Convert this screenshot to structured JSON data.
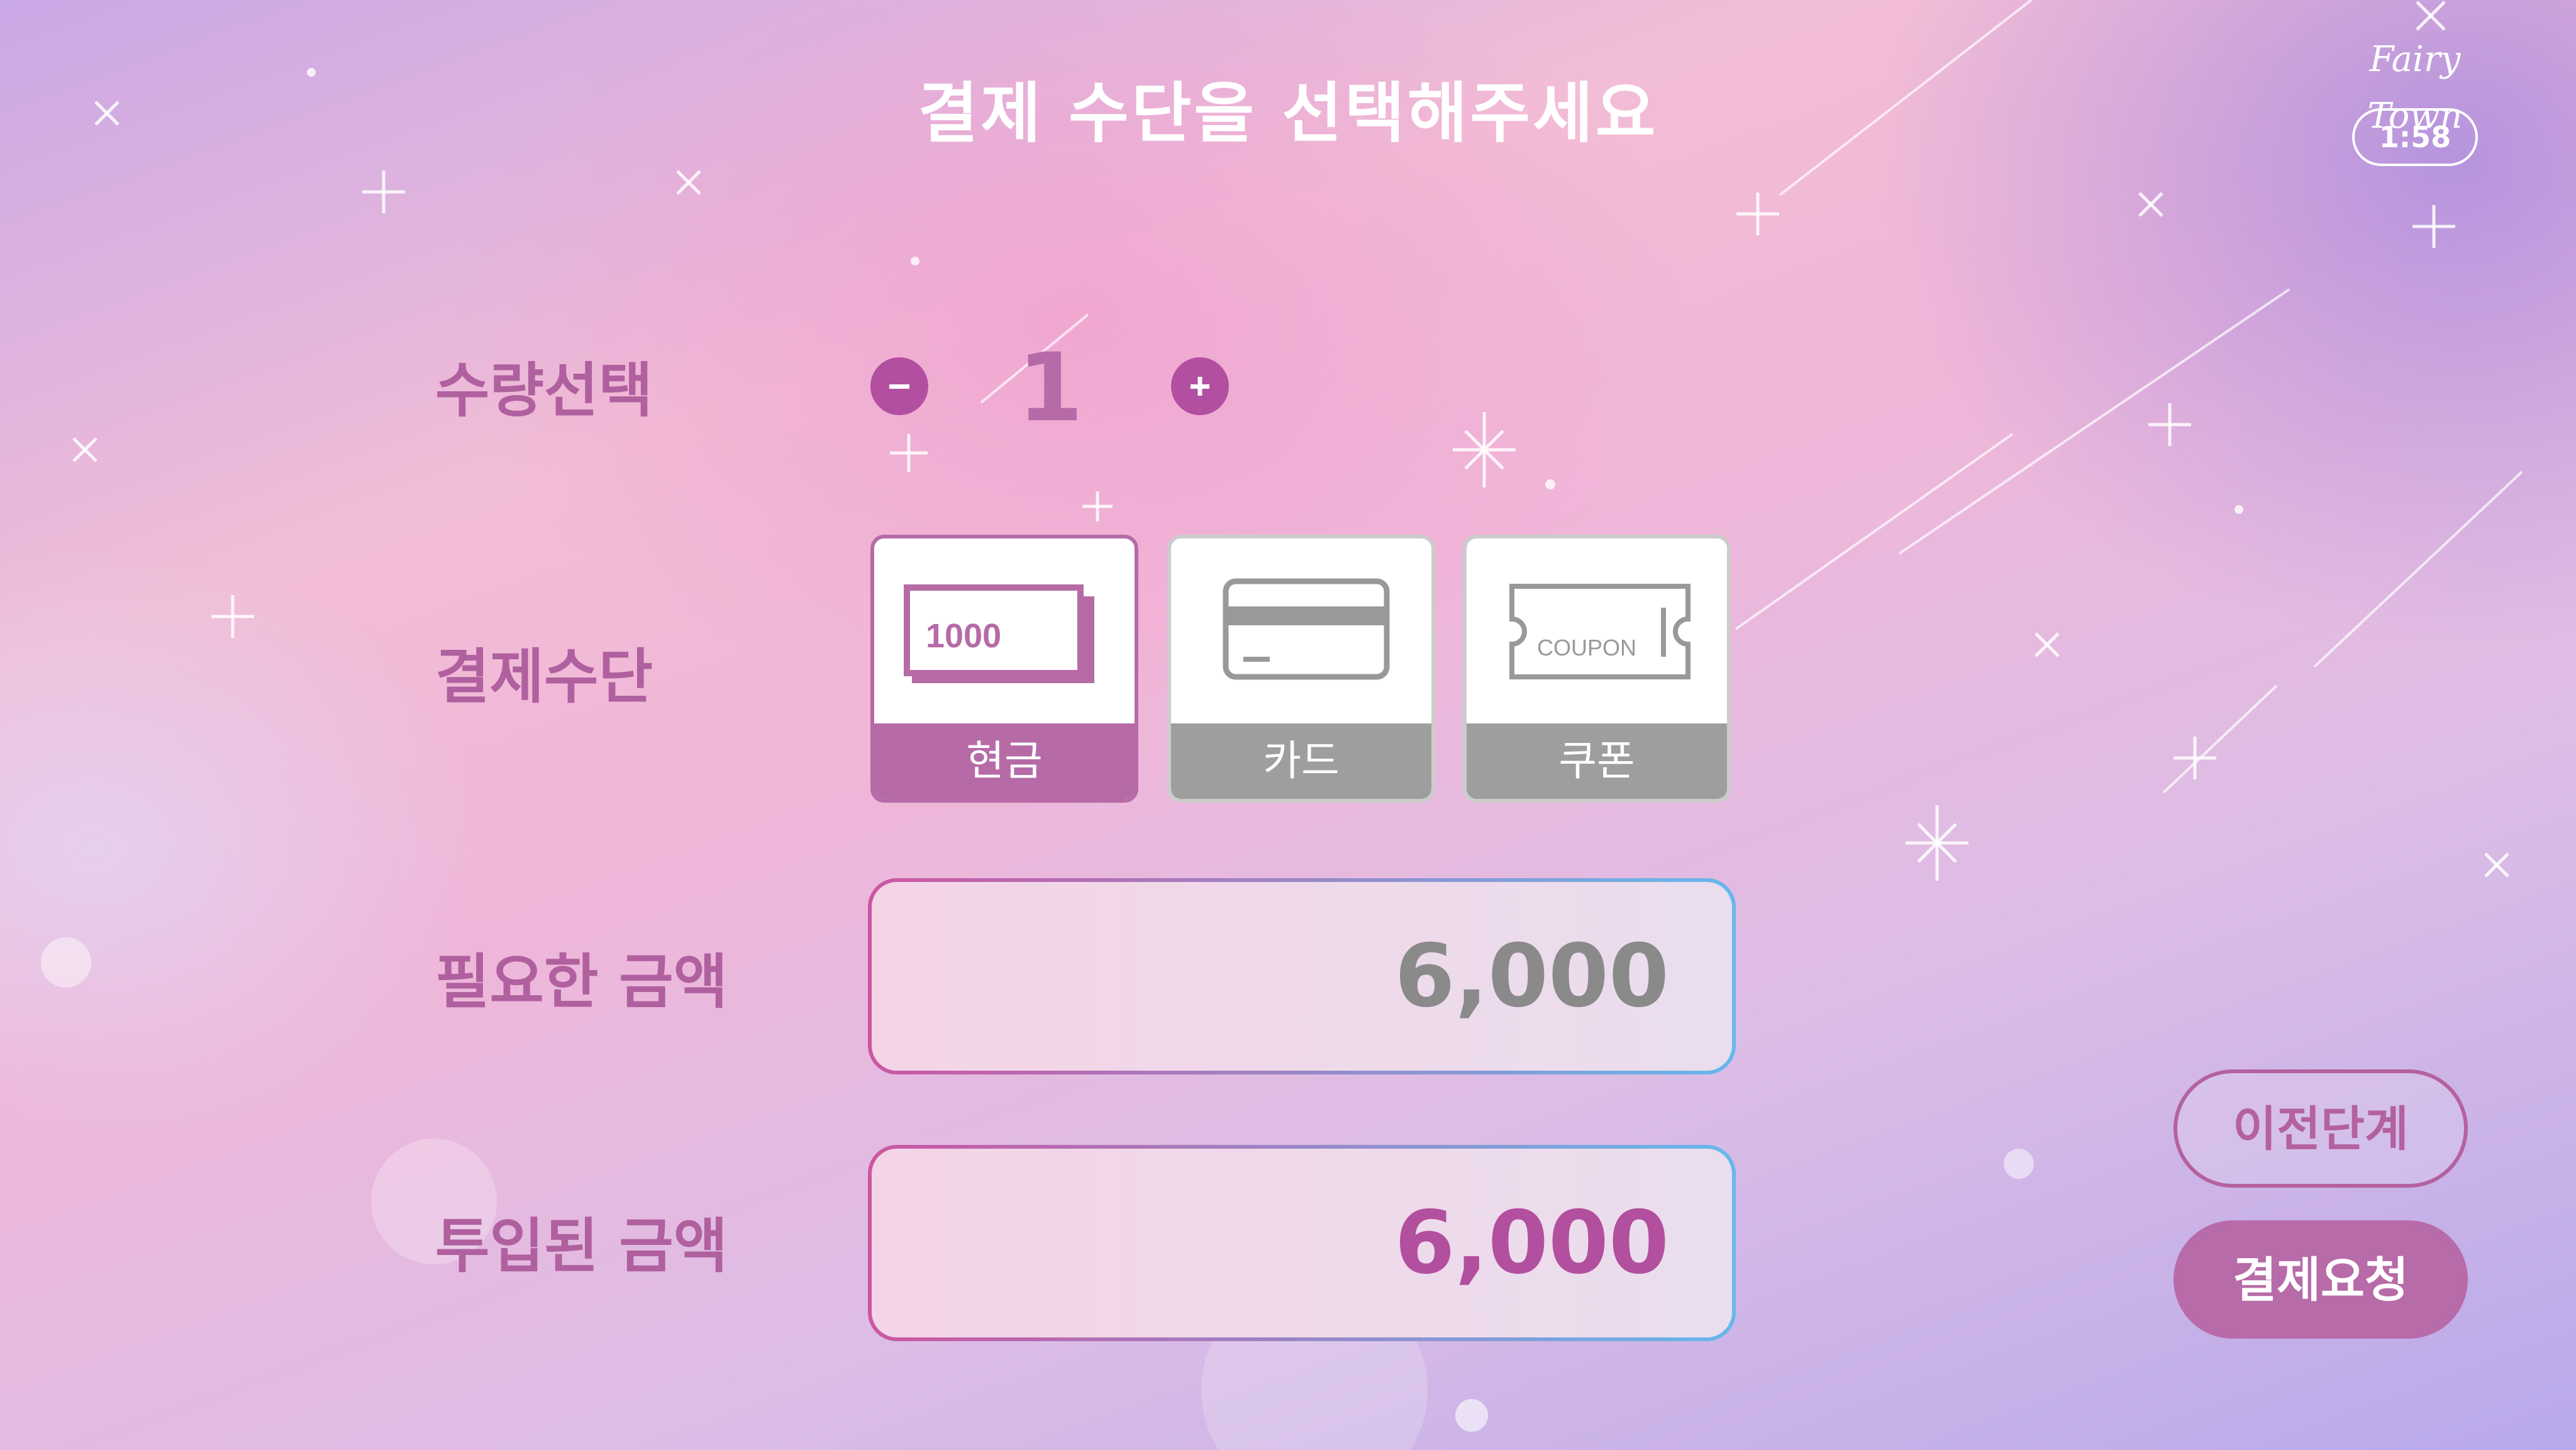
{
  "header": {
    "title": "결제 수단을 선택해주세요",
    "logo_text": "Fairy Town",
    "timer": "1:58"
  },
  "quantity": {
    "label": "수량선택",
    "value": "1",
    "minus_icon": "minus-icon",
    "plus_icon": "plus-icon"
  },
  "payment": {
    "label": "결제수단",
    "methods": [
      {
        "label": "현금",
        "icon": "cash-icon",
        "icon_text": "1000",
        "selected": true
      },
      {
        "label": "카드",
        "icon": "credit-card-icon",
        "selected": false
      },
      {
        "label": "쿠폰",
        "icon": "coupon-icon",
        "icon_text": "COUPON",
        "selected": false
      }
    ]
  },
  "required_amount": {
    "label": "필요한 금액",
    "value": "6,000"
  },
  "inserted_amount": {
    "label": "투입된 금액",
    "value": "6,000"
  },
  "buttons": {
    "previous": "이전단계",
    "request_payment": "결제요청"
  },
  "colors": {
    "accent": "#b76ba8",
    "label": "#b0609f",
    "required_value": "#8a8a8a",
    "inserted_value": "#b24f9e",
    "tile_unselected": "#9e9e9e"
  }
}
